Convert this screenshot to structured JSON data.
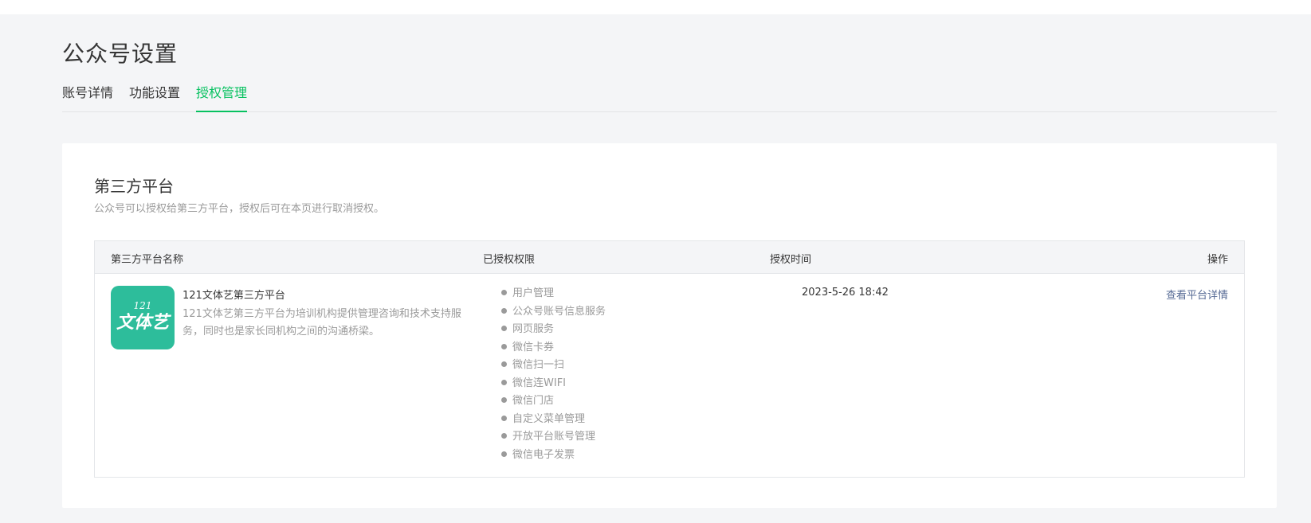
{
  "page": {
    "title": "公众号设置"
  },
  "tabs": [
    {
      "label": "账号详情"
    },
    {
      "label": "功能设置"
    },
    {
      "label": "授权管理",
      "active": true
    }
  ],
  "section": {
    "title": "第三方平台",
    "description": "公众号可以授权给第三方平台，授权后可在本页进行取消授权。"
  },
  "table": {
    "headers": {
      "name": "第三方平台名称",
      "permissions": "已授权权限",
      "time": "授权时间",
      "action": "操作"
    },
    "row": {
      "logo": {
        "top_text": "121",
        "main_text": "文体艺",
        "color": "#2dbd9b"
      },
      "name": "121文体艺第三方平台",
      "description": "121文体艺第三方平台为培训机构提供管理咨询和技术支持服务，同时也是家长同机构之间的沟通桥梁。",
      "permissions": [
        "用户管理",
        "公众号账号信息服务",
        "网页服务",
        "微信卡券",
        "微信扫一扫",
        "微信连WIFI",
        "微信门店",
        "自定义菜单管理",
        "开放平台账号管理",
        "微信电子发票"
      ],
      "auth_time": "2023-5-26 18:42",
      "action_label": "查看平台详情"
    }
  },
  "colors": {
    "accent": "#07c160",
    "link": "#576b95",
    "muted_text": "#9a9a9a"
  }
}
